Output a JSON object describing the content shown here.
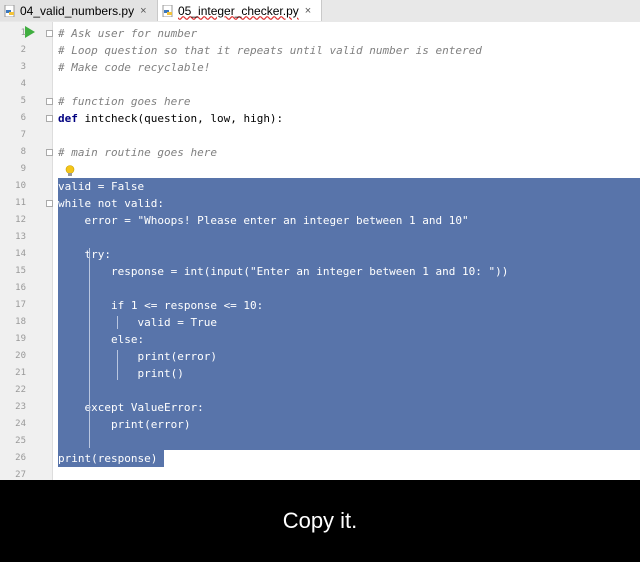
{
  "tabs": [
    {
      "label": "04_valid_numbers.py",
      "close": "×"
    },
    {
      "label": "05_integer_checker.py",
      "close": "×"
    }
  ],
  "line_numbers": [
    "1",
    "2",
    "3",
    "4",
    "5",
    "6",
    "7",
    "8",
    "9",
    "10",
    "11",
    "12",
    "13",
    "14",
    "15",
    "16",
    "17",
    "18",
    "19",
    "20",
    "21",
    "22",
    "23",
    "24",
    "25",
    "26",
    "27"
  ],
  "code": {
    "l1": "# Ask user for number",
    "l2": "# Loop question so that it repeats until valid number is entered",
    "l3": "# Make code recyclable!",
    "l5": "# function goes here",
    "l6_kw": "def",
    "l6_name": "intcheck",
    "l6_rest": "(question, low, high):",
    "l8": "# main routine goes here",
    "l10": "valid = False",
    "l11": "while not valid:",
    "l12": "    error = \"Whoops! Please enter an integer between 1 and 10\"",
    "l14": "    try:",
    "l15": "        response = int(input(\"Enter an integer between 1 and 10: \"))",
    "l17": "        if 1 <= response <= 10:",
    "l18": "            valid = True",
    "l19": "        else:",
    "l20": "            print(error)",
    "l21": "            print()",
    "l23": "    except ValueError:",
    "l24": "        print(error)",
    "l26": "print(response)"
  },
  "caption": "Copy it.",
  "colors": {
    "selection": "#5874aa",
    "run": "#3fae3f"
  }
}
